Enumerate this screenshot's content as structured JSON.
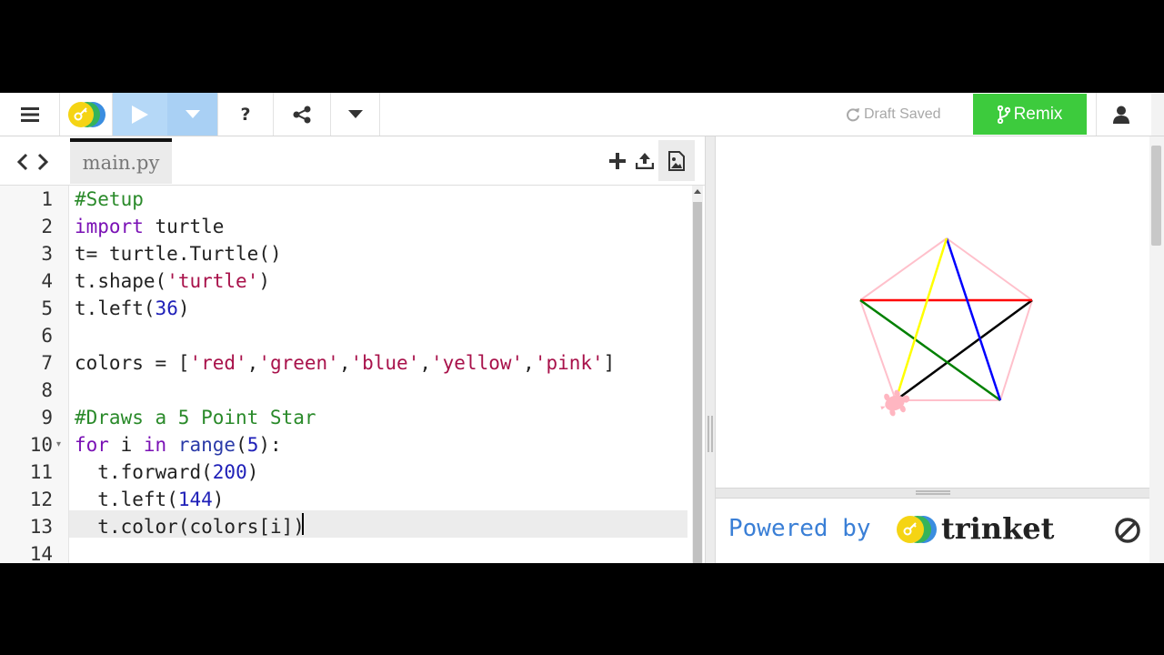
{
  "toolbar": {
    "menu_icon": "hamburger-icon",
    "logo_icon": "trinket-logo-icon",
    "run_icon": "play-icon",
    "run_menu_icon": "caret-down-icon",
    "help_label": "?",
    "share_icon": "share-icon",
    "more_icon": "caret-down-icon",
    "status": "Draft Saved",
    "status_icon": "refresh-icon",
    "remix_label": "Remix",
    "remix_icon": "branch-icon",
    "user_icon": "user-icon"
  },
  "editor": {
    "nav_icons": [
      "chevron-left-icon",
      "chevron-right-icon"
    ],
    "file_tab": "main.py",
    "file_actions": [
      "add-file-icon",
      "upload-icon",
      "image-icon"
    ],
    "line_numbers": [
      "1",
      "2",
      "3",
      "4",
      "5",
      "6",
      "7",
      "8",
      "9",
      "10",
      "11",
      "12",
      "13",
      "14"
    ],
    "active_line": 13,
    "code": [
      "#Setup",
      "import turtle",
      "t= turtle.Turtle()",
      "t.shape('turtle')",
      "t.left(36)",
      "",
      "colors = ['red','green','blue','yellow','pink']",
      "",
      "#Draws a 5 Point Star",
      "for i in range(5):",
      "  t.forward(200)",
      "  t.left(144)",
      "  t.color(colors[i])",
      ""
    ]
  },
  "output": {
    "star_colors": [
      "#000000",
      "#008000",
      "#ff0000",
      "#0000ff",
      "#ffff00"
    ],
    "pentagon_color": "#ffc0cb",
    "turtle_color": "#ffb6c1"
  },
  "footer": {
    "powered_by": "Powered by",
    "brand": "trinket",
    "stop_icon": "stop-icon"
  },
  "colors": {
    "run_button": "#b5d8f7",
    "remix_button": "#3dcb3d",
    "link_blue": "#3a7fd6"
  }
}
